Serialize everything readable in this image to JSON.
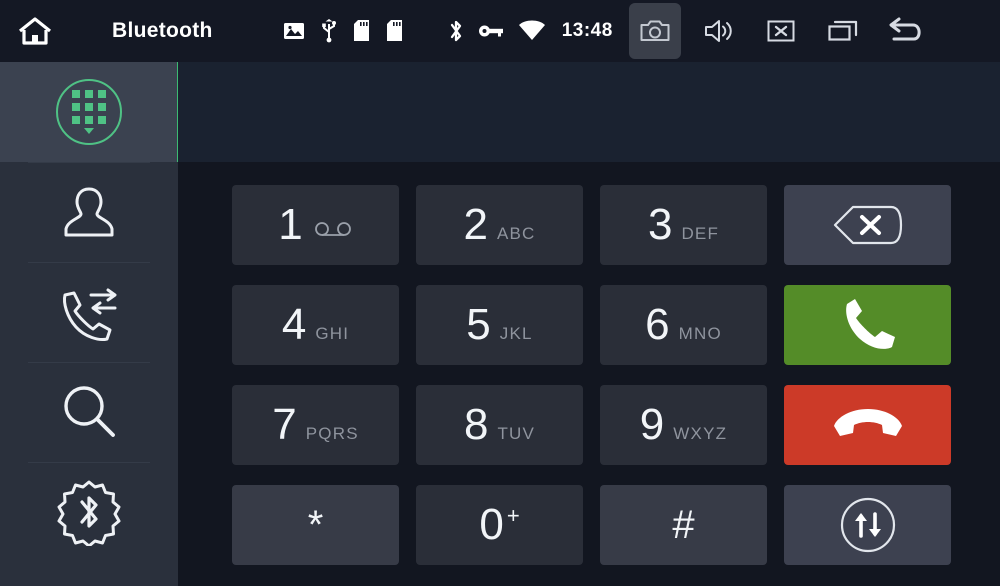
{
  "statusbar": {
    "title": "Bluetooth",
    "clock": "13:48",
    "home_icon": "home-icon",
    "left_icons": [
      "gallery-icon",
      "usb-icon",
      "sdcard-icon",
      "sdcard2-icon"
    ],
    "right_icons": [
      "bluetooth-icon",
      "vpn-key-icon",
      "wifi-icon"
    ],
    "action_icons": [
      "camera-icon",
      "volume-icon",
      "close-icon",
      "recent-apps-icon",
      "back-icon"
    ],
    "camera_active": true,
    "background": "#141824"
  },
  "sidebar": {
    "background": "#2a303c",
    "active_background": "#3b4250",
    "accent": "#3cba72",
    "items": [
      {
        "id": "dialpad",
        "icon": "dialpad-icon",
        "active": true
      },
      {
        "id": "contacts",
        "icon": "contacts-icon",
        "active": false
      },
      {
        "id": "call-log",
        "icon": "call-history-icon",
        "active": false
      },
      {
        "id": "search",
        "icon": "search-icon",
        "active": false
      },
      {
        "id": "bt-settings",
        "icon": "bluetooth-settings-icon",
        "active": false
      }
    ]
  },
  "display": {
    "number": "",
    "placeholder": "",
    "background": "#1a2230"
  },
  "keypad": {
    "keys": [
      {
        "digit": "1",
        "letters": "",
        "icon": "voicemail-icon",
        "style": "dark"
      },
      {
        "digit": "2",
        "letters": "ABC",
        "icon": "",
        "style": "dark"
      },
      {
        "digit": "3",
        "letters": "DEF",
        "icon": "",
        "style": "dark"
      },
      {
        "digit": "4",
        "letters": "GHI",
        "icon": "",
        "style": "dark"
      },
      {
        "digit": "5",
        "letters": "JKL",
        "icon": "",
        "style": "dark"
      },
      {
        "digit": "6",
        "letters": "MNO",
        "icon": "",
        "style": "dark"
      },
      {
        "digit": "7",
        "letters": "PQRS",
        "icon": "",
        "style": "dark"
      },
      {
        "digit": "8",
        "letters": "TUV",
        "icon": "",
        "style": "dark"
      },
      {
        "digit": "9",
        "letters": "WXYZ",
        "icon": "",
        "style": "dark"
      },
      {
        "digit": "*",
        "letters": "",
        "icon": "",
        "style": "light"
      },
      {
        "digit": "0",
        "letters": "",
        "superscript": "+",
        "icon": "",
        "style": "dark"
      },
      {
        "digit": "#",
        "letters": "",
        "icon": "",
        "style": "light"
      }
    ],
    "actions": [
      {
        "id": "backspace",
        "icon": "backspace-icon",
        "color": "#3d4150"
      },
      {
        "id": "call",
        "icon": "call-icon",
        "color": "#548c28"
      },
      {
        "id": "hangup",
        "icon": "hangup-icon",
        "color": "#cc3a28"
      },
      {
        "id": "audio-transfer",
        "icon": "audio-transfer-icon",
        "color": "#3d4150"
      }
    ]
  }
}
